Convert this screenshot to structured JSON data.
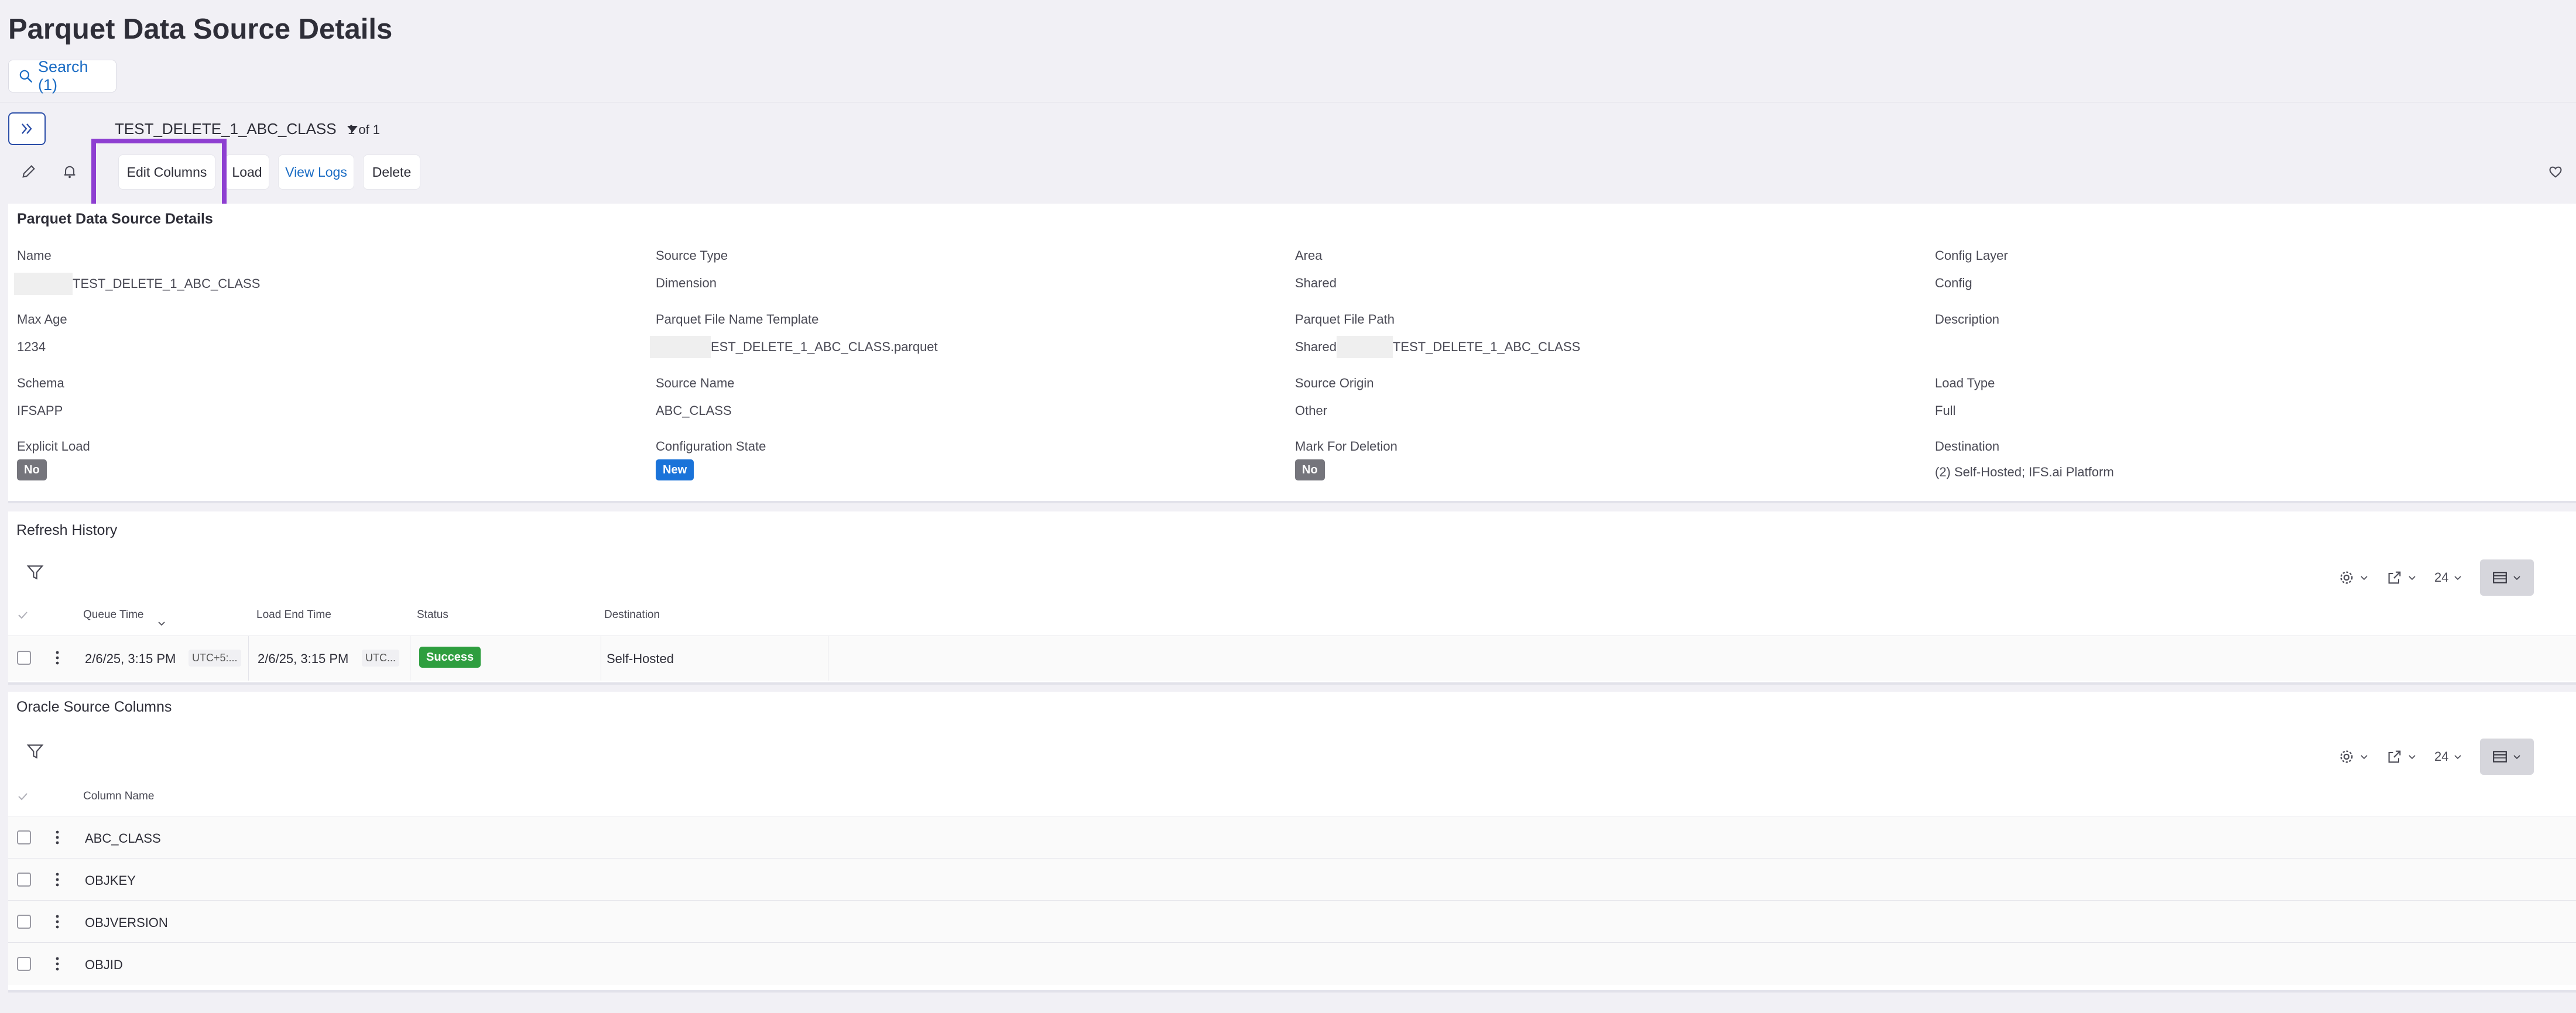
{
  "page": {
    "title": "Parquet Data Source Details",
    "search_label": "Search (1)"
  },
  "record": {
    "name": "TEST_DELETE_1_ABC_CLASS",
    "count": "1 of 1"
  },
  "toolbar": {
    "edit_columns": "Edit Columns",
    "load": "Load",
    "view_logs": "View Logs",
    "delete": "Delete"
  },
  "details": {
    "title": "Parquet Data Source Details",
    "fields": {
      "name": {
        "label": "Name",
        "value": "TEST_DELETE_1_ABC_CLASS"
      },
      "source_type": {
        "label": "Source Type",
        "value": "Dimension"
      },
      "area": {
        "label": "Area",
        "value": "Shared"
      },
      "config_layer": {
        "label": "Config Layer",
        "value": "Config"
      },
      "max_age": {
        "label": "Max Age",
        "value": "1234"
      },
      "parquet_template": {
        "label": "Parquet File Name Template",
        "value": "EST_DELETE_1_ABC_CLASS.parquet"
      },
      "parquet_path": {
        "label": "Parquet File Path",
        "prefix": "Shared",
        "value": "TEST_DELETE_1_ABC_CLASS"
      },
      "description": {
        "label": "Description",
        "value": ""
      },
      "schema": {
        "label": "Schema",
        "value": "IFSAPP"
      },
      "source_name": {
        "label": "Source Name",
        "value": "ABC_CLASS"
      },
      "source_origin": {
        "label": "Source Origin",
        "value": "Other"
      },
      "load_type": {
        "label": "Load Type",
        "value": "Full"
      },
      "explicit_load": {
        "label": "Explicit Load",
        "value": "No"
      },
      "configuration_state": {
        "label": "Configuration State",
        "value": "New"
      },
      "mark_for_deletion": {
        "label": "Mark For Deletion",
        "value": "No"
      },
      "destination": {
        "label": "Destination",
        "value": "(2) Self-Hosted; IFS.ai Platform"
      }
    }
  },
  "refresh_history": {
    "title": "Refresh History",
    "page_size": "24",
    "columns": [
      "Queue Time",
      "Load End Time",
      "Status",
      "Destination"
    ],
    "rows": [
      {
        "queue_time": "2/6/25, 3:15 PM",
        "queue_tz": "UTC+5:...",
        "load_end_time": "2/6/25, 3:15 PM",
        "load_tz": "UTC...",
        "status": "Success",
        "destination": "Self-Hosted"
      }
    ]
  },
  "oracle_columns": {
    "title": "Oracle Source Columns",
    "page_size": "24",
    "columns": [
      "Column Name"
    ],
    "rows": [
      "ABC_CLASS",
      "OBJKEY",
      "OBJVERSION",
      "OBJID"
    ]
  },
  "colors": {
    "accent": "#1a6cc4",
    "highlight": "#8e3fd1",
    "success": "#2e9e3f",
    "new_badge": "#1a73d9",
    "no_badge": "#75757c"
  }
}
